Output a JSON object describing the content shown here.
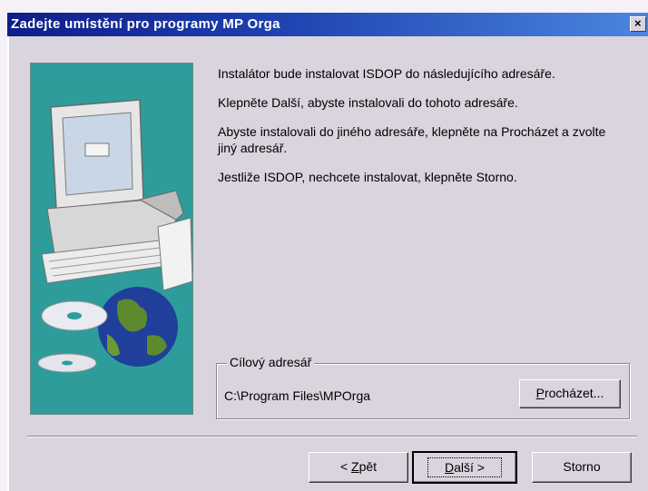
{
  "window": {
    "title": "Zadejte umístění pro programy MP Orga",
    "close_glyph": "×"
  },
  "content": {
    "paragraphs": [
      "Instalátor bude instalovat ISDOP do následujícího adresáře.",
      "Klepněte Další, abyste instalovali do tohoto adresáře.",
      "Abyste instalovali do jiného adresáře, klepněte na Procházet a zvolte jiný adresář.",
      "Jestliže ISDOP, nechcete instalovat, klepněte Storno."
    ]
  },
  "destination": {
    "group_label": "Cílový adresář",
    "path": "C:\\Program Files\\MPOrga",
    "browse_prefix": "P",
    "browse_rest": "rocházet..."
  },
  "buttons": {
    "back_prefix": "< ",
    "back_mnemonic": "Z",
    "back_rest": "pět",
    "next_mnemonic": "D",
    "next_rest": "alší >",
    "cancel": "Storno"
  },
  "colors": {
    "title_bar_start": "#0e1d8a",
    "title_bar_end": "#4a86e0",
    "dialog_face": "#d9d4dd",
    "illustration_bg": "#2e9c9b"
  }
}
